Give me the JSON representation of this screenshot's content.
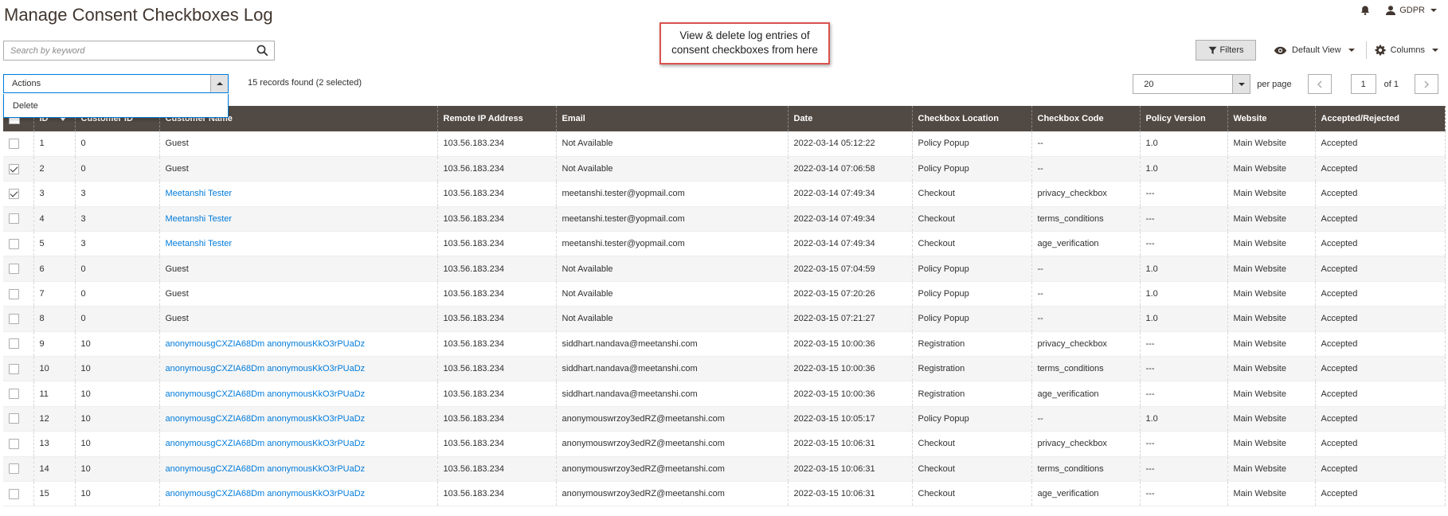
{
  "page": {
    "title": "Manage Consent Checkboxes Log"
  },
  "header": {
    "user_label": "GDPR"
  },
  "search": {
    "placeholder": "Search by keyword"
  },
  "callout": {
    "line1": "View & delete log entries of",
    "line2": "consent checkboxes from here"
  },
  "toolbar": {
    "filters_label": "Filters",
    "view_label": "Default View",
    "columns_label": "Columns"
  },
  "actions": {
    "label": "Actions",
    "menu_items": [
      "Delete"
    ]
  },
  "records_text": "15 records found (2 selected)",
  "pager": {
    "per_page_value": "20",
    "per_page_label": "per page",
    "page_value": "1",
    "of_label": "of 1"
  },
  "table": {
    "columns": [
      "ID",
      "Customer ID",
      "Customer Name",
      "Remote IP Address",
      "Email",
      "Date",
      "Checkbox Location",
      "Checkbox Code",
      "Policy Version",
      "Website",
      "Accepted/Rejected"
    ],
    "rows": [
      {
        "checked": false,
        "id": "1",
        "customer_id": "0",
        "name": "Guest",
        "name_link": false,
        "ip": "103.56.183.234",
        "email": "Not Available",
        "date": "2022-03-14 05:12:22",
        "location": "Policy Popup",
        "code": "--",
        "version": "1.0",
        "website": "Main Website",
        "status": "Accepted"
      },
      {
        "checked": true,
        "id": "2",
        "customer_id": "0",
        "name": "Guest",
        "name_link": false,
        "ip": "103.56.183.234",
        "email": "Not Available",
        "date": "2022-03-14 07:06:58",
        "location": "Policy Popup",
        "code": "--",
        "version": "1.0",
        "website": "Main Website",
        "status": "Accepted"
      },
      {
        "checked": true,
        "id": "3",
        "customer_id": "3",
        "name": "Meetanshi Tester",
        "name_link": true,
        "ip": "103.56.183.234",
        "email": "meetanshi.tester@yopmail.com",
        "date": "2022-03-14 07:49:34",
        "location": "Checkout",
        "code": "privacy_checkbox",
        "version": "---",
        "website": "Main Website",
        "status": "Accepted"
      },
      {
        "checked": false,
        "id": "4",
        "customer_id": "3",
        "name": "Meetanshi Tester",
        "name_link": true,
        "ip": "103.56.183.234",
        "email": "meetanshi.tester@yopmail.com",
        "date": "2022-03-14 07:49:34",
        "location": "Checkout",
        "code": "terms_conditions",
        "version": "---",
        "website": "Main Website",
        "status": "Accepted"
      },
      {
        "checked": false,
        "id": "5",
        "customer_id": "3",
        "name": "Meetanshi Tester",
        "name_link": true,
        "ip": "103.56.183.234",
        "email": "meetanshi.tester@yopmail.com",
        "date": "2022-03-14 07:49:34",
        "location": "Checkout",
        "code": "age_verification",
        "version": "---",
        "website": "Main Website",
        "status": "Accepted"
      },
      {
        "checked": false,
        "id": "6",
        "customer_id": "0",
        "name": "Guest",
        "name_link": false,
        "ip": "103.56.183.234",
        "email": "Not Available",
        "date": "2022-03-15 07:04:59",
        "location": "Policy Popup",
        "code": "--",
        "version": "1.0",
        "website": "Main Website",
        "status": "Accepted"
      },
      {
        "checked": false,
        "id": "7",
        "customer_id": "0",
        "name": "Guest",
        "name_link": false,
        "ip": "103.56.183.234",
        "email": "Not Available",
        "date": "2022-03-15 07:20:26",
        "location": "Policy Popup",
        "code": "--",
        "version": "1.0",
        "website": "Main Website",
        "status": "Accepted"
      },
      {
        "checked": false,
        "id": "8",
        "customer_id": "0",
        "name": "Guest",
        "name_link": false,
        "ip": "103.56.183.234",
        "email": "Not Available",
        "date": "2022-03-15 07:21:27",
        "location": "Policy Popup",
        "code": "--",
        "version": "1.0",
        "website": "Main Website",
        "status": "Accepted"
      },
      {
        "checked": false,
        "id": "9",
        "customer_id": "10",
        "name": "anonymousgCXZIA68Dm anonymousKkO3rPUaDz",
        "name_link": true,
        "ip": "103.56.183.234",
        "email": "siddhart.nandava@meetanshi.com",
        "date": "2022-03-15 10:00:36",
        "location": "Registration",
        "code": "privacy_checkbox",
        "version": "---",
        "website": "Main Website",
        "status": "Accepted"
      },
      {
        "checked": false,
        "id": "10",
        "customer_id": "10",
        "name": "anonymousgCXZIA68Dm anonymousKkO3rPUaDz",
        "name_link": true,
        "ip": "103.56.183.234",
        "email": "siddhart.nandava@meetanshi.com",
        "date": "2022-03-15 10:00:36",
        "location": "Registration",
        "code": "terms_conditions",
        "version": "---",
        "website": "Main Website",
        "status": "Accepted"
      },
      {
        "checked": false,
        "id": "11",
        "customer_id": "10",
        "name": "anonymousgCXZIA68Dm anonymousKkO3rPUaDz",
        "name_link": true,
        "ip": "103.56.183.234",
        "email": "siddhart.nandava@meetanshi.com",
        "date": "2022-03-15 10:00:36",
        "location": "Registration",
        "code": "age_verification",
        "version": "---",
        "website": "Main Website",
        "status": "Accepted"
      },
      {
        "checked": false,
        "id": "12",
        "customer_id": "10",
        "name": "anonymousgCXZIA68Dm anonymousKkO3rPUaDz",
        "name_link": true,
        "ip": "103.56.183.234",
        "email": "anonymouswrzoy3edRZ@meetanshi.com",
        "date": "2022-03-15 10:05:17",
        "location": "Policy Popup",
        "code": "--",
        "version": "1.0",
        "website": "Main Website",
        "status": "Accepted"
      },
      {
        "checked": false,
        "id": "13",
        "customer_id": "10",
        "name": "anonymousgCXZIA68Dm anonymousKkO3rPUaDz",
        "name_link": true,
        "ip": "103.56.183.234",
        "email": "anonymouswrzoy3edRZ@meetanshi.com",
        "date": "2022-03-15 10:06:31",
        "location": "Checkout",
        "code": "privacy_checkbox",
        "version": "---",
        "website": "Main Website",
        "status": "Accepted"
      },
      {
        "checked": false,
        "id": "14",
        "customer_id": "10",
        "name": "anonymousgCXZIA68Dm anonymousKkO3rPUaDz",
        "name_link": true,
        "ip": "103.56.183.234",
        "email": "anonymouswrzoy3edRZ@meetanshi.com",
        "date": "2022-03-15 10:06:31",
        "location": "Checkout",
        "code": "terms_conditions",
        "version": "---",
        "website": "Main Website",
        "status": "Accepted"
      },
      {
        "checked": false,
        "id": "15",
        "customer_id": "10",
        "name": "anonymousgCXZIA68Dm anonymousKkO3rPUaDz",
        "name_link": true,
        "ip": "103.56.183.234",
        "email": "anonymouswrzoy3edRZ@meetanshi.com",
        "date": "2022-03-15 10:06:31",
        "location": "Checkout",
        "code": "age_verification",
        "version": "---",
        "website": "Main Website",
        "status": "Accepted"
      }
    ]
  },
  "colors": {
    "header_bg": "#514943",
    "link": "#007bdb",
    "callout_border": "#d9534f"
  }
}
